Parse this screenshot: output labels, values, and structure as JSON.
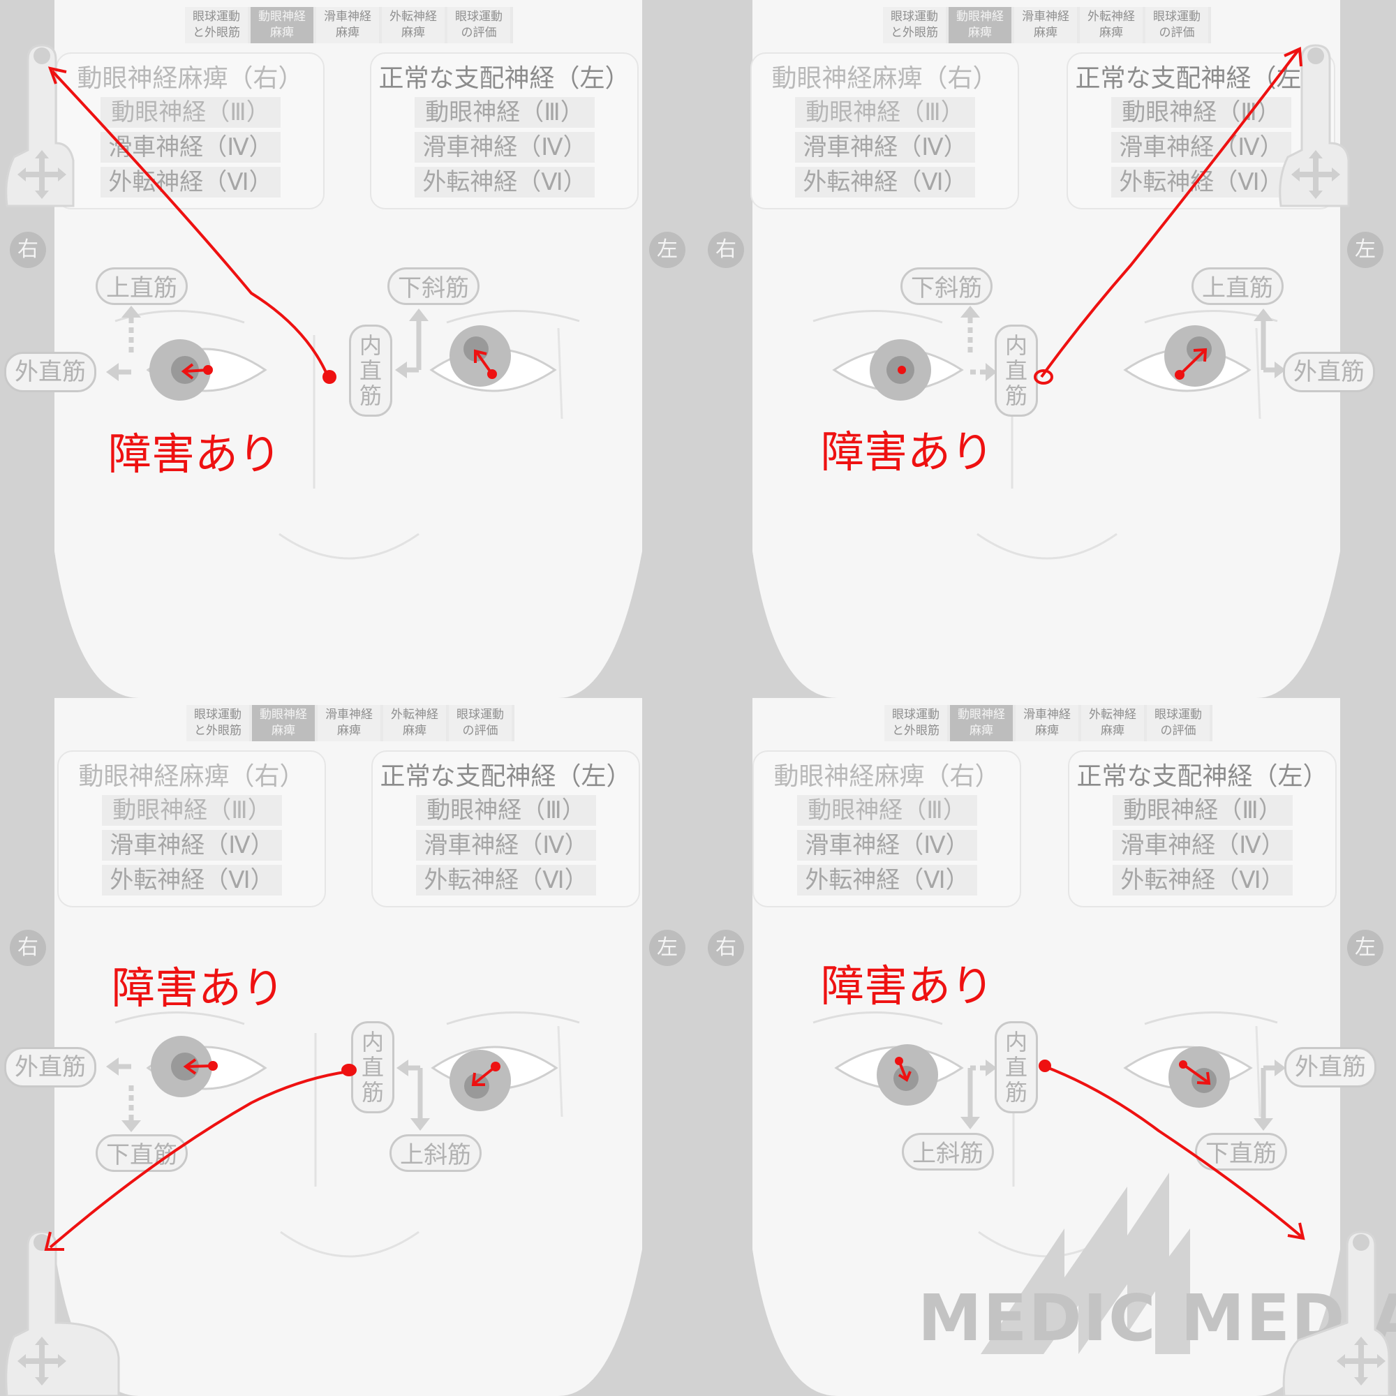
{
  "tabs": [
    {
      "line1": "眼球運動",
      "line2": "と外眼筋"
    },
    {
      "line1": "動眼神経",
      "line2": "麻痺"
    },
    {
      "line1": "滑車神経",
      "line2": "麻痺"
    },
    {
      "line1": "外転神経",
      "line2": "麻痺"
    },
    {
      "line1": "眼球運動",
      "line2": "の評価"
    }
  ],
  "box_left": {
    "title": "動眼神経麻痺（右）",
    "nerves": [
      "動眼神経（Ⅲ）",
      "滑車神経（Ⅳ）",
      "外転神経（Ⅵ）"
    ]
  },
  "box_right": {
    "title": "正常な支配神経（左）",
    "nerves": [
      "動眼神経（Ⅲ）",
      "滑車神経（Ⅳ）",
      "外転神経（Ⅵ）"
    ]
  },
  "side_right": "右",
  "side_left": "左",
  "muscles": {
    "superior_rectus": "上直筋",
    "inferior_oblique": "下斜筋",
    "lateral_rectus": "外直筋",
    "medial_rectus": [
      "内",
      "直",
      "筋"
    ],
    "inferior_rectus": "下直筋",
    "superior_oblique": "上斜筋"
  },
  "annotation": "障害あり",
  "watermark": "MEDIC MEDIA",
  "colors": {
    "annotation": "#ee1111",
    "active_tab": "#bdbdbd",
    "face": "#f6f6f6"
  }
}
